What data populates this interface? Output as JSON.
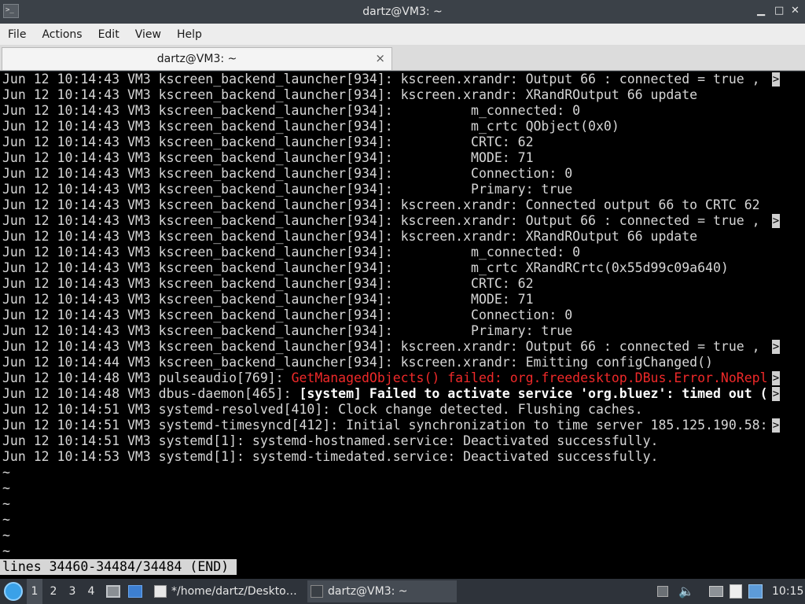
{
  "window": {
    "title": "dartz@VM3: ~",
    "controls": {
      "minimize": "▁",
      "maximize": "□",
      "close": "✕"
    }
  },
  "menu": [
    "File",
    "Actions",
    "Edit",
    "View",
    "Help"
  ],
  "tab": {
    "label": "dartz@VM3: ~",
    "close": "×"
  },
  "terminal": {
    "lines": [
      {
        "text": "Jun 12 10:14:43 VM3 kscreen_backend_launcher[934]: kscreen.xrandr: Output 66 : connected = true , ",
        "trunc": true
      },
      {
        "text": "Jun 12 10:14:43 VM3 kscreen_backend_launcher[934]: kscreen.xrandr: XRandROutput 66 update"
      },
      {
        "text": "Jun 12 10:14:43 VM3 kscreen_backend_launcher[934]:          m_connected: 0"
      },
      {
        "text": "Jun 12 10:14:43 VM3 kscreen_backend_launcher[934]:          m_crtc QObject(0x0)"
      },
      {
        "text": "Jun 12 10:14:43 VM3 kscreen_backend_launcher[934]:          CRTC: 62"
      },
      {
        "text": "Jun 12 10:14:43 VM3 kscreen_backend_launcher[934]:          MODE: 71"
      },
      {
        "text": "Jun 12 10:14:43 VM3 kscreen_backend_launcher[934]:          Connection: 0"
      },
      {
        "text": "Jun 12 10:14:43 VM3 kscreen_backend_launcher[934]:          Primary: true"
      },
      {
        "text": "Jun 12 10:14:43 VM3 kscreen_backend_launcher[934]: kscreen.xrandr: Connected output 66 to CRTC 62"
      },
      {
        "text": "Jun 12 10:14:43 VM3 kscreen_backend_launcher[934]: kscreen.xrandr: Output 66 : connected = true , ",
        "trunc": true
      },
      {
        "text": "Jun 12 10:14:43 VM3 kscreen_backend_launcher[934]: kscreen.xrandr: XRandROutput 66 update"
      },
      {
        "text": "Jun 12 10:14:43 VM3 kscreen_backend_launcher[934]:          m_connected: 0"
      },
      {
        "text": "Jun 12 10:14:43 VM3 kscreen_backend_launcher[934]:          m_crtc XRandRCrtc(0x55d99c09a640)"
      },
      {
        "text": "Jun 12 10:14:43 VM3 kscreen_backend_launcher[934]:          CRTC: 62"
      },
      {
        "text": "Jun 12 10:14:43 VM3 kscreen_backend_launcher[934]:          MODE: 71"
      },
      {
        "text": "Jun 12 10:14:43 VM3 kscreen_backend_launcher[934]:          Connection: 0"
      },
      {
        "text": "Jun 12 10:14:43 VM3 kscreen_backend_launcher[934]:          Primary: true"
      },
      {
        "text": "Jun 12 10:14:43 VM3 kscreen_backend_launcher[934]: kscreen.xrandr: Output 66 : connected = true , ",
        "trunc": true
      },
      {
        "text": "Jun 12 10:14:44 VM3 kscreen_backend_launcher[934]: kscreen.xrandr: Emitting configChanged()"
      },
      {
        "text": "Jun 12 10:14:48 VM3 pulseaudio[769]: ",
        "red": "GetManagedObjects() failed: org.freedesktop.DBus.Error.NoRepl",
        "trunc": true
      },
      {
        "text": "Jun 12 10:14:48 VM3 dbus-daemon[465]: ",
        "bold": "[system] Failed to activate service 'org.bluez': timed out (",
        "trunc": true
      },
      {
        "text": "Jun 12 10:14:51 VM3 systemd-resolved[410]: Clock change detected. Flushing caches."
      },
      {
        "text": "Jun 12 10:14:51 VM3 systemd-timesyncd[412]: Initial synchronization to time server 185.125.190.58:",
        "trunc": true
      },
      {
        "text": "Jun 12 10:14:51 VM3 systemd[1]: systemd-hostnamed.service: Deactivated successfully."
      },
      {
        "text": "Jun 12 10:14:53 VM3 systemd[1]: systemd-timedated.service: Deactivated successfully."
      }
    ],
    "trunc_marker": ">",
    "tilde": "~",
    "tilde_count": 6,
    "status": "lines 34460-34484/34484 (END)"
  },
  "taskbar": {
    "workspaces": [
      "1",
      "2",
      "3",
      "4"
    ],
    "active_workspace": "1",
    "windows": [
      {
        "label": "*/home/dartz/Deskto…",
        "icon": "text-editor-icon"
      },
      {
        "label": "dartz@VM3: ~",
        "icon": "terminal-icon"
      }
    ],
    "clock": "10:15"
  }
}
